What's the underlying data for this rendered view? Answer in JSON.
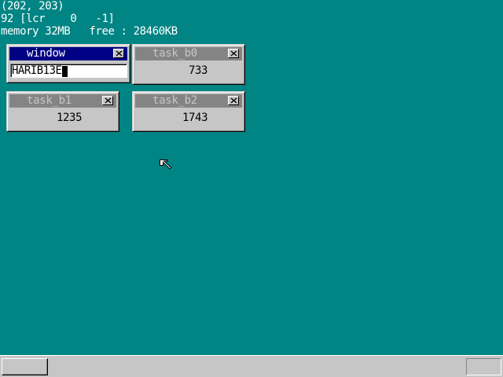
{
  "debug": {
    "mouse_coords": "(202, 203)",
    "mouse_data": "92 [lcr    0   -1]",
    "memory_line": "memory 32MB   free : 28460KB"
  },
  "windows": {
    "window": {
      "title": "window",
      "textbox_value": "HARIB13E",
      "active": true
    },
    "task_b0": {
      "title": "task_b0",
      "counter": "733"
    },
    "task_b1": {
      "title": "task_b1",
      "counter": "1235"
    },
    "task_b2": {
      "title": "task_b2",
      "counter": "1743"
    }
  },
  "colors": {
    "desktop": "#008484",
    "window_face": "#c6c6c6",
    "active_title": "#000084",
    "inactive_title": "#848484"
  },
  "icons": {
    "close": "close-icon",
    "pointer": "mouse-pointer-icon"
  }
}
